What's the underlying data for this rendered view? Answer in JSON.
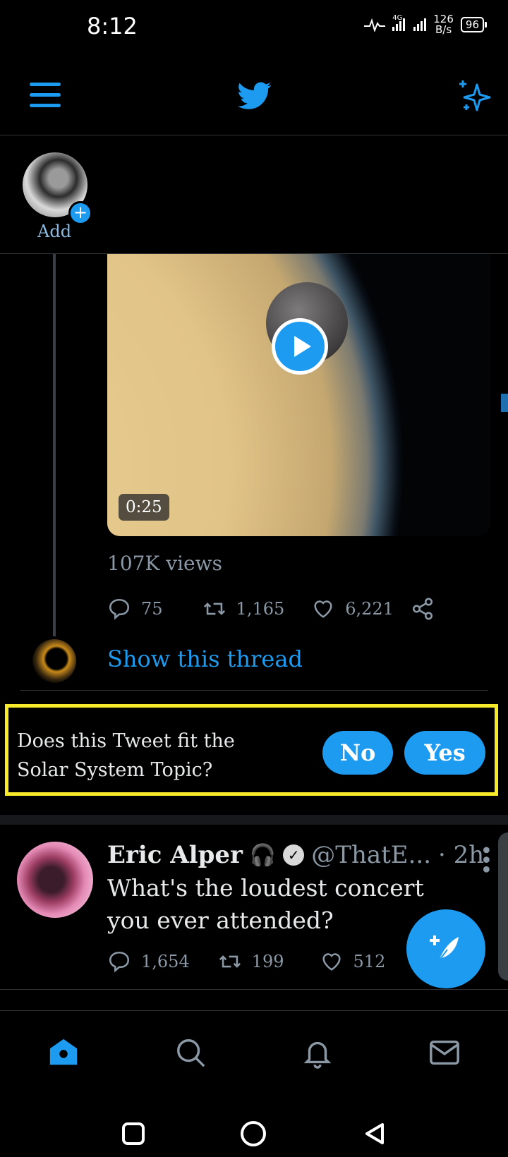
{
  "status_bar": {
    "time": "8:12",
    "network": "4G",
    "speed_value": "126",
    "speed_unit": "B/s",
    "battery": "96"
  },
  "fleets": {
    "add_label": "Add"
  },
  "tweet_media": {
    "duration": "0:25",
    "views": "107K views",
    "replies": "75",
    "retweets": "1,165",
    "likes": "6,221",
    "show_thread": "Show this thread"
  },
  "topic_prompt": {
    "question_line1": "Does this Tweet fit the",
    "question_line2": "Solar System Topic?",
    "no_label": "No",
    "yes_label": "Yes"
  },
  "tweet2": {
    "name": "Eric Alper",
    "emoji": "🎧",
    "handle": "@ThatE...",
    "time": "· 2h",
    "text": "What's the loudest concert you ever attended?",
    "replies": "1,654",
    "retweets": "199",
    "likes": "512"
  },
  "colors": {
    "accent": "#1d9bf0",
    "highlight_border": "#f6ea2b",
    "background": "#000000"
  }
}
